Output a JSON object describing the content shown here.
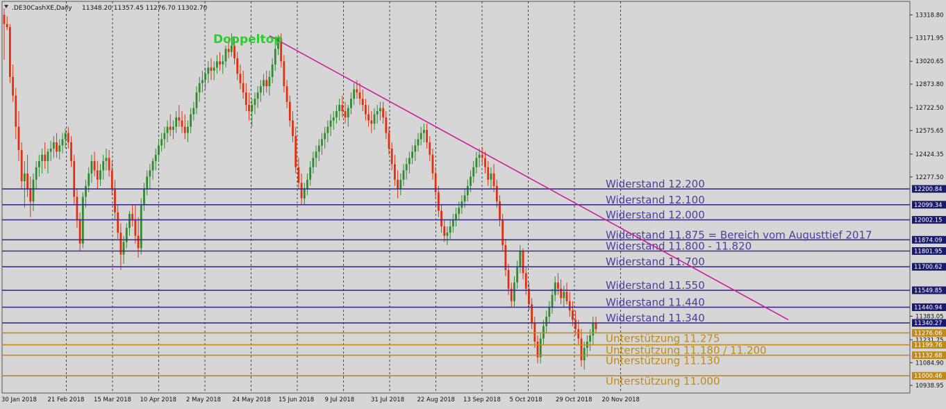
{
  "header": {
    "symbol_label": ".DE30CashXE,Daily",
    "ohlc_text": "11348.20 11357.45 11276.70 11302.70",
    "menu_icon": "triangle-down-icon"
  },
  "annotations": {
    "pattern_label": "Doppeltop"
  },
  "colors": {
    "background": "#d6d6d6",
    "bull_candle": "#2e8b2e",
    "bear_candle": "#e03010",
    "resistance_line": "#3a2f8e",
    "resistance_text": "#4a3f9e",
    "support_line": "#c08a1a",
    "support_text": "#c08a1a",
    "trend_line": "#cc1f9a",
    "pattern_label": "#2ecc2e",
    "label_box": "#1a1a6e",
    "orange_label_box": "#c08a1a"
  },
  "chart_data": {
    "type": "candlestick",
    "symbol": ".DE30CashXE",
    "timeframe": "Daily",
    "ylim": [
      10938.95,
      13392.5
    ],
    "date_range": [
      "2018-01-30",
      "2018-11-30"
    ],
    "y_ticks": [
      {
        "value": 13318.8,
        "label": "13318.80"
      },
      {
        "value": 13171.95,
        "label": "13171.95"
      },
      {
        "value": 13020.65,
        "label": "13020.65"
      },
      {
        "value": 12873.8,
        "label": "12873.80"
      },
      {
        "value": 12722.5,
        "label": "12722.50"
      },
      {
        "value": 12575.65,
        "label": "12575.65"
      },
      {
        "value": 12424.35,
        "label": "12424.35"
      },
      {
        "value": 12277.5,
        "label": "12277.50"
      },
      {
        "value": 11383.05,
        "label": "11383.05"
      },
      {
        "value": 11231.75,
        "label": "11231.75"
      },
      {
        "value": 11084.9,
        "label": "11084.90"
      },
      {
        "value": 10938.95,
        "label": "10938.95"
      }
    ],
    "x_ticks": [
      "30 Jan 2018",
      "21 Feb 2018",
      "15 Mar 2018",
      "10 Apr 2018",
      "2 May 2018",
      "24 May 2018",
      "15 Jun 2018",
      "9 Jul 2018",
      "31 Jul 2018",
      "22 Aug 2018",
      "13 Sep 2018",
      "5 Oct 2018",
      "29 Oct 2018",
      "20 Nov 2018"
    ],
    "horizontal_levels": [
      {
        "kind": "resistance",
        "value": 12200.84,
        "price_label": "12200.84",
        "text": "Widerstand 12.200"
      },
      {
        "kind": "resistance",
        "value": 12099.34,
        "price_label": "12099.34",
        "text": "Widerstand 12.100"
      },
      {
        "kind": "resistance",
        "value": 12002.15,
        "price_label": "12002.15",
        "text": "Widerstand 12.000"
      },
      {
        "kind": "resistance",
        "value": 11874.09,
        "price_label": "11874.09",
        "text": "Widerstand 11.875 = Bereich vom Augusttief 2017"
      },
      {
        "kind": "resistance",
        "value": 11801.95,
        "price_label": "11801.95",
        "text": "Widerstand 11.800 - 11.820"
      },
      {
        "kind": "resistance",
        "value": 11700.62,
        "price_label": "11700.62",
        "text": "Widerstand 11.700"
      },
      {
        "kind": "resistance",
        "value": 11549.85,
        "price_label": "11549.85",
        "text": "Widerstand 11.550"
      },
      {
        "kind": "resistance",
        "value": 11440.94,
        "price_label": "11440.94",
        "text": "Widerstand 11.440"
      },
      {
        "kind": "resistance",
        "value": 11340.27,
        "price_label": "11340.27",
        "text": "Widerstand 11.340"
      },
      {
        "kind": "support",
        "value": 11276.06,
        "price_label": "11276.06",
        "text": "Unterstützung 11.275"
      },
      {
        "kind": "support",
        "value": 11199.76,
        "price_label": "11199.76",
        "text": "Unterstützung 11.180 / 11.200"
      },
      {
        "kind": "support",
        "value": 11132.68,
        "price_label": "11132.68",
        "text": "Unterstützung 11.130"
      },
      {
        "kind": "support",
        "value": 11000.46,
        "price_label": "11000.46",
        "text": "Unterstützung 11.000"
      }
    ],
    "trendline": {
      "from": {
        "date": "2018-06-18",
        "value": 13185
      },
      "to": {
        "date": "2018-11-30",
        "value": 11360
      }
    },
    "candles": [
      [
        13320,
        13360,
        13030,
        13260
      ],
      [
        13260,
        13310,
        13220,
        13240
      ],
      [
        13240,
        13260,
        12880,
        12920
      ],
      [
        12920,
        13000,
        12760,
        12800
      ],
      [
        12800,
        12850,
        12520,
        12600
      ],
      [
        12600,
        12700,
        12380,
        12450
      ],
      [
        12450,
        12500,
        12200,
        12250
      ],
      [
        12250,
        12380,
        12080,
        12300
      ],
      [
        12300,
        12420,
        12150,
        12200
      ],
      [
        12200,
        12280,
        12020,
        12120
      ],
      [
        12120,
        12300,
        12060,
        12260
      ],
      [
        12260,
        12380,
        12200,
        12340
      ],
      [
        12340,
        12420,
        12280,
        12380
      ],
      [
        12380,
        12460,
        12300,
        12420
      ],
      [
        12420,
        12500,
        12330,
        12380
      ],
      [
        12380,
        12460,
        12300,
        12440
      ],
      [
        12440,
        12510,
        12380,
        12460
      ],
      [
        12460,
        12540,
        12400,
        12500
      ],
      [
        12500,
        12560,
        12400,
        12440
      ],
      [
        12440,
        12520,
        12390,
        12480
      ],
      [
        12480,
        12560,
        12430,
        12520
      ],
      [
        12520,
        12590,
        12460,
        12560
      ],
      [
        12560,
        12600,
        12460,
        12500
      ],
      [
        12500,
        12540,
        12340,
        12380
      ],
      [
        12380,
        12420,
        12100,
        12150
      ],
      [
        12150,
        12200,
        11950,
        12000
      ],
      [
        12000,
        12050,
        11800,
        11850
      ],
      [
        11850,
        12180,
        11820,
        12150
      ],
      [
        12150,
        12260,
        12080,
        12220
      ],
      [
        12220,
        12340,
        12180,
        12300
      ],
      [
        12300,
        12420,
        12240,
        12380
      ],
      [
        12380,
        12440,
        12280,
        12320
      ],
      [
        12320,
        12380,
        12200,
        12260
      ],
      [
        12260,
        12360,
        12220,
        12320
      ],
      [
        12320,
        12420,
        12260,
        12380
      ],
      [
        12380,
        12460,
        12320,
        12400
      ],
      [
        12400,
        12450,
        12280,
        12320
      ],
      [
        12320,
        12380,
        12160,
        12200
      ],
      [
        12200,
        12260,
        12000,
        12050
      ],
      [
        12050,
        12100,
        11880,
        11920
      ],
      [
        11920,
        11980,
        11680,
        11780
      ],
      [
        11780,
        11900,
        11720,
        11860
      ],
      [
        11860,
        11980,
        11820,
        11950
      ],
      [
        11950,
        12060,
        11900,
        12040
      ],
      [
        12040,
        12100,
        11960,
        12000
      ],
      [
        12000,
        12100,
        11850,
        11900
      ],
      [
        11900,
        12020,
        11760,
        11820
      ],
      [
        11820,
        12140,
        11780,
        12100
      ],
      [
        12100,
        12240,
        12060,
        12200
      ],
      [
        12200,
        12320,
        12160,
        12280
      ],
      [
        12280,
        12360,
        12200,
        12320
      ],
      [
        12320,
        12400,
        12260,
        12380
      ],
      [
        12380,
        12460,
        12320,
        12420
      ],
      [
        12420,
        12520,
        12380,
        12480
      ],
      [
        12480,
        12560,
        12440,
        12520
      ],
      [
        12520,
        12600,
        12460,
        12560
      ],
      [
        12560,
        12640,
        12500,
        12600
      ],
      [
        12600,
        12680,
        12540,
        12580
      ],
      [
        12580,
        12640,
        12520,
        12600
      ],
      [
        12600,
        12700,
        12560,
        12660
      ],
      [
        12660,
        12740,
        12600,
        12640
      ],
      [
        12640,
        12700,
        12560,
        12600
      ],
      [
        12600,
        12680,
        12520,
        12560
      ],
      [
        12560,
        12640,
        12500,
        12600
      ],
      [
        12600,
        12720,
        12560,
        12680
      ],
      [
        12680,
        12760,
        12640,
        12720
      ],
      [
        12720,
        12860,
        12680,
        12820
      ],
      [
        12820,
        12920,
        12760,
        12880
      ],
      [
        12880,
        12960,
        12820,
        12900
      ],
      [
        12900,
        12980,
        12840,
        12940
      ],
      [
        12940,
        13020,
        12880,
        12980
      ],
      [
        12980,
        13040,
        12900,
        12960
      ],
      [
        12960,
        13020,
        12900,
        12980
      ],
      [
        12980,
        13060,
        12940,
        13020
      ],
      [
        13020,
        13080,
        12960,
        13000
      ],
      [
        13000,
        13060,
        12940,
        13020
      ],
      [
        13020,
        13120,
        12980,
        13100
      ],
      [
        13100,
        13160,
        13040,
        13080
      ],
      [
        13080,
        13200,
        13050,
        13120
      ],
      [
        13120,
        13180,
        13000,
        13040
      ],
      [
        13040,
        13080,
        12900,
        12940
      ],
      [
        12940,
        13000,
        12840,
        12880
      ],
      [
        12880,
        12960,
        12780,
        12820
      ],
      [
        12820,
        12880,
        12700,
        12740
      ],
      [
        12740,
        12820,
        12640,
        12700
      ],
      [
        12700,
        12780,
        12600,
        12740
      ],
      [
        12740,
        12820,
        12680,
        12780
      ],
      [
        12780,
        12860,
        12720,
        12820
      ],
      [
        12820,
        12900,
        12760,
        12860
      ],
      [
        12860,
        12940,
        12800,
        12900
      ],
      [
        12900,
        12960,
        12820,
        12860
      ],
      [
        12860,
        12960,
        12800,
        12920
      ],
      [
        12920,
        13040,
        12880,
        13000
      ],
      [
        13000,
        13120,
        12960,
        13100
      ],
      [
        13100,
        13190,
        13060,
        13170
      ],
      [
        13170,
        13200,
        12980,
        13020
      ],
      [
        13020,
        13060,
        12820,
        12860
      ],
      [
        12860,
        12900,
        12720,
        12760
      ],
      [
        12760,
        12800,
        12600,
        12640
      ],
      [
        12640,
        12700,
        12500,
        12540
      ],
      [
        12540,
        12600,
        12300,
        12340
      ],
      [
        12340,
        12400,
        12200,
        12240
      ],
      [
        12240,
        12300,
        12100,
        12140
      ],
      [
        12140,
        12240,
        12100,
        12200
      ],
      [
        12200,
        12300,
        12160,
        12260
      ],
      [
        12260,
        12380,
        12220,
        12340
      ],
      [
        12340,
        12440,
        12300,
        12400
      ],
      [
        12400,
        12480,
        12340,
        12440
      ],
      [
        12440,
        12520,
        12380,
        12480
      ],
      [
        12480,
        12560,
        12420,
        12520
      ],
      [
        12520,
        12600,
        12460,
        12560
      ],
      [
        12560,
        12640,
        12500,
        12600
      ],
      [
        12600,
        12680,
        12540,
        12640
      ],
      [
        12640,
        12700,
        12580,
        12660
      ],
      [
        12660,
        12740,
        12620,
        12700
      ],
      [
        12700,
        12780,
        12640,
        12740
      ],
      [
        12740,
        12800,
        12660,
        12700
      ],
      [
        12700,
        12760,
        12620,
        12660
      ],
      [
        12660,
        12740,
        12600,
        12720
      ],
      [
        12720,
        12820,
        12680,
        12780
      ],
      [
        12780,
        12880,
        12740,
        12840
      ],
      [
        12840,
        12900,
        12780,
        12820
      ],
      [
        12820,
        12880,
        12740,
        12780
      ],
      [
        12780,
        12840,
        12700,
        12740
      ],
      [
        12740,
        12780,
        12640,
        12680
      ],
      [
        12680,
        12740,
        12600,
        12640
      ],
      [
        12640,
        12700,
        12560,
        12620
      ],
      [
        12620,
        12720,
        12580,
        12680
      ],
      [
        12680,
        12740,
        12620,
        12700
      ],
      [
        12700,
        12760,
        12640,
        12720
      ],
      [
        12720,
        12760,
        12620,
        12660
      ],
      [
        12660,
        12700,
        12520,
        12560
      ],
      [
        12560,
        12600,
        12420,
        12460
      ],
      [
        12460,
        12500,
        12320,
        12360
      ],
      [
        12360,
        12420,
        12220,
        12260
      ],
      [
        12260,
        12320,
        12140,
        12200
      ],
      [
        12200,
        12300,
        12160,
        12260
      ],
      [
        12260,
        12360,
        12220,
        12320
      ],
      [
        12320,
        12400,
        12260,
        12360
      ],
      [
        12360,
        12440,
        12300,
        12400
      ],
      [
        12400,
        12480,
        12360,
        12440
      ],
      [
        12440,
        12520,
        12380,
        12480
      ],
      [
        12480,
        12560,
        12440,
        12520
      ],
      [
        12520,
        12600,
        12480,
        12560
      ],
      [
        12560,
        12620,
        12500,
        12580
      ],
      [
        12580,
        12620,
        12460,
        12500
      ],
      [
        12500,
        12540,
        12380,
        12420
      ],
      [
        12420,
        12460,
        12260,
        12300
      ],
      [
        12300,
        12340,
        12140,
        12180
      ],
      [
        12180,
        12220,
        12020,
        12060
      ],
      [
        12060,
        12100,
        11920,
        11960
      ],
      [
        11960,
        12000,
        11860,
        11900
      ],
      [
        11900,
        11960,
        11840,
        11920
      ],
      [
        11920,
        12000,
        11880,
        11960
      ],
      [
        11960,
        12040,
        11920,
        12000
      ],
      [
        12000,
        12080,
        11960,
        12040
      ],
      [
        12040,
        12120,
        12000,
        12080
      ],
      [
        12080,
        12160,
        12040,
        12120
      ],
      [
        12120,
        12200,
        12080,
        12160
      ],
      [
        12160,
        12260,
        12120,
        12220
      ],
      [
        12220,
        12320,
        12180,
        12280
      ],
      [
        12280,
        12380,
        12240,
        12340
      ],
      [
        12340,
        12440,
        12300,
        12400
      ],
      [
        12400,
        12460,
        12340,
        12420
      ],
      [
        12420,
        12470,
        12360,
        12400
      ],
      [
        12400,
        12440,
        12300,
        12340
      ],
      [
        12340,
        12380,
        12220,
        12260
      ],
      [
        12260,
        12340,
        12200,
        12300
      ],
      [
        12300,
        12360,
        12180,
        12220
      ],
      [
        12220,
        12260,
        12080,
        12120
      ],
      [
        12120,
        12160,
        11960,
        12000
      ],
      [
        12000,
        12040,
        11800,
        11840
      ],
      [
        11840,
        11880,
        11640,
        11680
      ],
      [
        11680,
        11720,
        11520,
        11560
      ],
      [
        11560,
        11600,
        11440,
        11480
      ],
      [
        11480,
        11640,
        11440,
        11600
      ],
      [
        11600,
        11740,
        11560,
        11700
      ],
      [
        11700,
        11840,
        11660,
        11800
      ],
      [
        11800,
        11820,
        11620,
        11660
      ],
      [
        11660,
        11700,
        11520,
        11560
      ],
      [
        11560,
        11600,
        11420,
        11460
      ],
      [
        11460,
        11500,
        11300,
        11340
      ],
      [
        11340,
        11380,
        11180,
        11220
      ],
      [
        11220,
        11260,
        11080,
        11120
      ],
      [
        11120,
        11280,
        11080,
        11240
      ],
      [
        11240,
        11360,
        11200,
        11320
      ],
      [
        11320,
        11420,
        11280,
        11380
      ],
      [
        11380,
        11480,
        11340,
        11440
      ],
      [
        11440,
        11560,
        11400,
        11520
      ],
      [
        11520,
        11640,
        11480,
        11600
      ],
      [
        11600,
        11660,
        11520,
        11560
      ],
      [
        11560,
        11620,
        11460,
        11500
      ],
      [
        11500,
        11580,
        11440,
        11540
      ],
      [
        11540,
        11600,
        11460,
        11480
      ],
      [
        11480,
        11540,
        11380,
        11420
      ],
      [
        11420,
        11480,
        11320,
        11360
      ],
      [
        11360,
        11420,
        11260,
        11300
      ],
      [
        11300,
        11360,
        11200,
        11240
      ],
      [
        11240,
        11300,
        11060,
        11100
      ],
      [
        11100,
        11220,
        11040,
        11180
      ],
      [
        11180,
        11260,
        11120,
        11220
      ],
      [
        11220,
        11300,
        11160,
        11260
      ],
      [
        11260,
        11380,
        11200,
        11340
      ],
      [
        11340,
        11380,
        11280,
        11300
      ]
    ]
  }
}
